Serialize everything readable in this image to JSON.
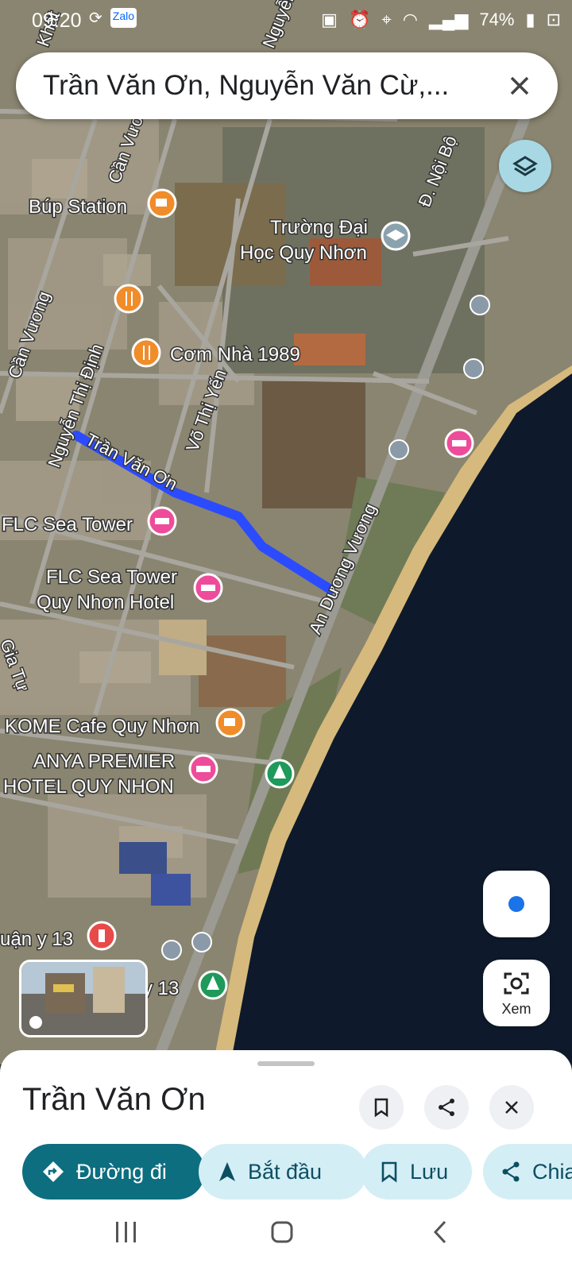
{
  "status_bar": {
    "time": "09:20",
    "battery": "74%"
  },
  "search": {
    "query": "Trần Văn Ơn, Nguyễn Văn Cừ,..."
  },
  "map": {
    "streets": [
      "Nguyễn Thị Định",
      "Cần Vương",
      "Cần Vương",
      "Võ Thị Yến",
      "Trần Văn Ơn",
      "An Dương Vương",
      "Đ. Nội Bộ",
      "Nguyễn",
      "Gia Tự",
      "Khất"
    ],
    "places": {
      "bup_station": "Búp Station",
      "university_line1": "Trường Đại",
      "university_line2": "Học Quy Nhơn",
      "com_nha": "Cơm Nhà 1989",
      "flc_tower": "FLC Sea Tower",
      "flc_hotel_line1": "FLC Sea Tower",
      "flc_hotel_line2": "Quy Nhơn Hotel",
      "kome": "KOME Cafe Quy Nhơn",
      "anya_line1": "ANYA PREMIER",
      "anya_line2": "HOTEL QUY NHON",
      "partial_top": "uận y 13",
      "partial_bottom": "y 13"
    },
    "route_color": "#2b4bff",
    "water_color": "#0e1a2b"
  },
  "xem_label": "Xem",
  "sheet": {
    "title": "Trần Văn Ơn",
    "actions": [
      {
        "label": "Đường đi",
        "icon": "directions-icon"
      },
      {
        "label": "Bắt đầu",
        "icon": "navigation-arrow-icon"
      },
      {
        "label": "Lưu",
        "icon": "bookmark-icon"
      },
      {
        "label": "Chia sẻ",
        "icon": "share-icon"
      }
    ]
  }
}
